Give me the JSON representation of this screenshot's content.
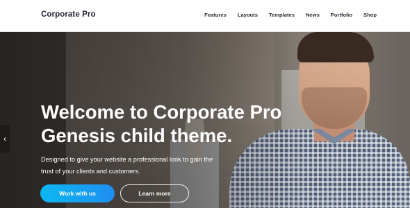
{
  "site": {
    "logo": "Corporate Pro"
  },
  "nav": {
    "items": [
      {
        "label": "Features"
      },
      {
        "label": "Layouts"
      },
      {
        "label": "Templates"
      },
      {
        "label": "News"
      },
      {
        "label": "Portfolio"
      },
      {
        "label": "Shop"
      }
    ]
  },
  "hero": {
    "headline_line1": "Welcome to Corporate Pro",
    "headline_line2": "Genesis child theme.",
    "sub_line1": "Designed to give your website a professional look to gain the",
    "sub_line2": "trust of your clients and customers.",
    "primary_button": "Work with us",
    "secondary_button": "Learn more",
    "prev_arrow": "‹"
  },
  "colors": {
    "accent_start": "#0db7f2",
    "accent_end": "#1f8ef0",
    "text_dark": "#1f2430"
  },
  "icons": {
    "prev": "chevron-left-icon"
  }
}
